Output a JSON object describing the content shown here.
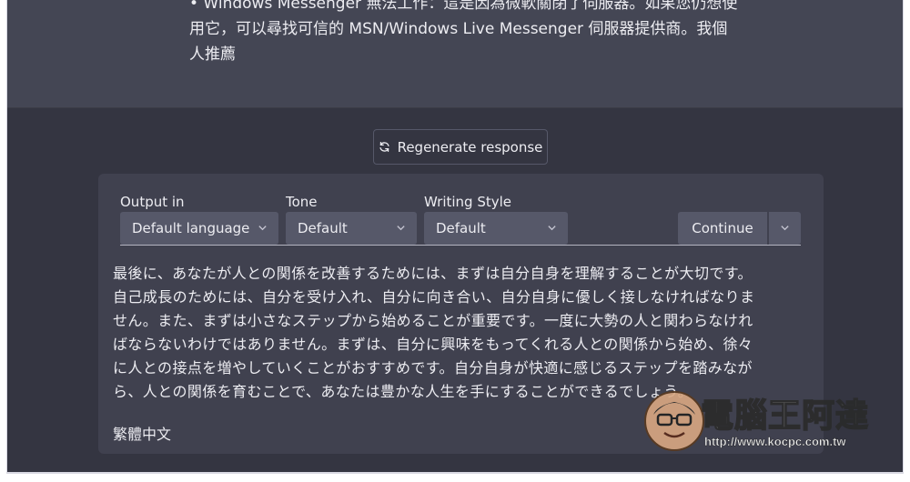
{
  "previous_message": {
    "lines": [
      "• Windows Messenger 無法工作：這是因為微軟關閉了伺服器。如果您仍想使",
      "用它，可以尋找可信的 MSN/Windows Live Messenger 伺服器提供商。我個",
      "人推薦"
    ]
  },
  "regenerate": {
    "label": "Regenerate response",
    "icon": "refresh-icon"
  },
  "controls": {
    "output_in": {
      "label": "Output in",
      "value": "Default language"
    },
    "tone": {
      "label": "Tone",
      "value": "Default"
    },
    "writing_style": {
      "label": "Writing Style",
      "value": "Default"
    },
    "continue_label": "Continue"
  },
  "response": {
    "lines": [
      "最後に、あなたが人との関係を改善するためには、まずは自分自身を理解することが大切です。",
      "自己成長のためには、自分を受け入れ、自分に向き合い、自分自身に優しく接しなければなりま",
      "せん。また、まずは小さなステップから始めることが重要です。一度に大勢の人と関わらなけれ",
      "ばならないわけではありません。まずは、自分に興味をもってくれる人との関係から始め、徐々",
      "に人との接点を増やしていくことがおすすめです。自分自身が快適に感じるステップを踏みなが",
      "ら、人との関係を育むことで、あなたは豊かな人生を手にすることができるでしょう。"
    ],
    "footer": "繁體中文"
  },
  "watermark": {
    "title": "電腦王阿達",
    "url": "http://www.kocpc.com.tw"
  }
}
